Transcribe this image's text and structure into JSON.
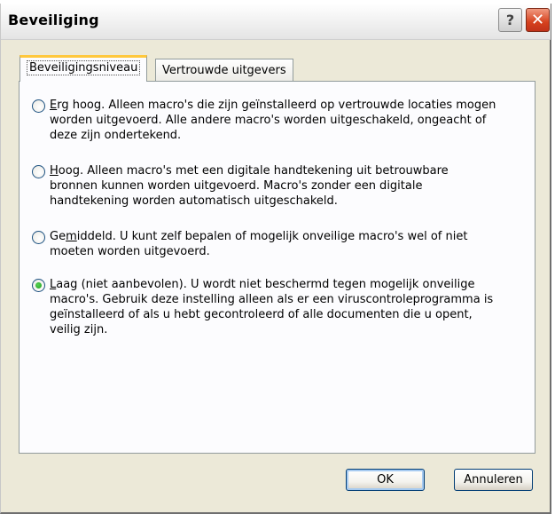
{
  "window": {
    "title": "Beveiliging",
    "help_label": "?",
    "close_label": "✕"
  },
  "tabs": [
    {
      "label": "Beveiligingsniveau",
      "active": true
    },
    {
      "label": "Vertrouwde uitgevers",
      "active": false
    }
  ],
  "options": [
    {
      "checked": false,
      "mnemonic": "E",
      "lines": [
        "rg hoog. Alleen macro's die zijn geïnstalleerd op vertrouwde locaties mogen",
        "worden uitgevoerd. Alle andere macro's worden uitgeschakeld, ongeacht of",
        "deze zijn ondertekend."
      ]
    },
    {
      "checked": false,
      "mnemonic": "H",
      "lines": [
        "oog. Alleen macro's met een digitale handtekening uit betrouwbare",
        "bronnen kunnen worden uitgevoerd. Macro's zonder een digitale",
        "handtekening worden automatisch uitgeschakeld."
      ]
    },
    {
      "checked": false,
      "prefix": "Ge",
      "mnemonic": "m",
      "lines": [
        "iddeld. U kunt zelf bepalen of mogelijk onveilige macro's wel of niet",
        "moeten worden uitgevoerd."
      ]
    },
    {
      "checked": true,
      "mnemonic": "L",
      "lines": [
        "aag (niet aanbevolen). U wordt niet beschermd tegen mogelijk onveilige",
        "macro's. Gebruik deze instelling alleen als er een viruscontroleprogramma is",
        "geïnstalleerd of als u hebt gecontroleerd of alle documenten die u opent,",
        "veilig zijn."
      ]
    }
  ],
  "buttons": {
    "ok_label": "OK",
    "cancel_label": "Annuleren"
  }
}
